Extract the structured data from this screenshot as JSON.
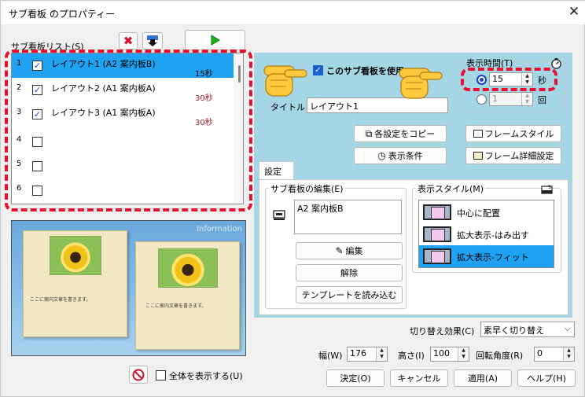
{
  "window": {
    "title": "サブ看板 のプロパティー",
    "close_glyph": "✕"
  },
  "sublist": {
    "label": "サブ看板リスト(S)",
    "rows": [
      {
        "num": "1",
        "label": "レイアウト1 (A2 案内板B)",
        "duration": "15秒",
        "checked": true,
        "selected": true
      },
      {
        "num": "2",
        "label": "レイアウト2 (A1 案内板A)",
        "duration": "30秒",
        "checked": true,
        "selected": false
      },
      {
        "num": "3",
        "label": "レイアウト3 (A1 案内板A)",
        "duration": "30秒",
        "checked": true,
        "selected": false
      },
      {
        "num": "4",
        "label": "",
        "duration": "",
        "checked": false,
        "selected": false
      },
      {
        "num": "5",
        "label": "",
        "duration": "",
        "checked": false,
        "selected": false
      },
      {
        "num": "6",
        "label": "",
        "duration": "",
        "checked": false,
        "selected": false
      }
    ]
  },
  "preview": {
    "info_text": "Information",
    "card_text": "ここに案内文章を書きます。",
    "show_all_label": "全体を表示する(U)"
  },
  "settings": {
    "use_label": "このサブ看板を使用",
    "title_label": "タイトル",
    "title_value": "レイアウト1",
    "display_time_label": "表示時間(T)",
    "time_value": "15",
    "time_unit": "秒",
    "count_value": "1",
    "count_unit": "回",
    "copy_label": "各設定をコピー",
    "condition_label": "表示条件",
    "frame_style_label": "フレームスタイル",
    "frame_detail_label": "フレーム詳細設定",
    "tab_label": "設定",
    "edit_group_label": "サブ看板の編集(E)",
    "board_value": "A2 案内板B",
    "edit_button": "編集",
    "release_button": "解除",
    "template_button": "テンプレートを読み込む",
    "style_group_label": "表示スタイル(M)",
    "styles": [
      "中心に配置",
      "拡大表示-はみ出す",
      "拡大表示-フィット"
    ],
    "switch_label": "切り替え効果(C)",
    "switch_value": "素早く切り替え",
    "width_label": "幅(W)",
    "width_value": "176",
    "height_label": "高さ(I)",
    "height_value": "100",
    "rotate_label": "回転角度(R)",
    "rotate_value": "0"
  },
  "footer": {
    "ok": "決定(O)",
    "cancel": "キャンセル",
    "apply": "適用(A)",
    "help": "ヘルプ(H)"
  },
  "colors": {
    "selection": "#1fa2f2",
    "highlight": "#e8102e",
    "panel": "#a5d6e5",
    "check": "#1a3fd1"
  }
}
